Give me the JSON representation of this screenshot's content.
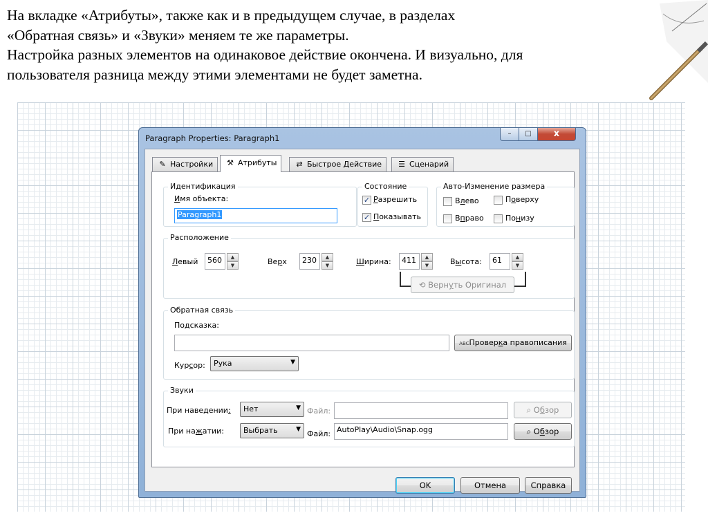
{
  "slide": {
    "line1": "На вкладке «Атрибуты», также как и в предыдущем случае, в разделах",
    "line2": "«Обратная связь» и «Звуки» меняем те же параметры.",
    "line3": "Настройка разных элементов на одинаковое действие окончена. И визуально, для",
    "line4": "пользователя разница между этими элементами не будет заметна."
  },
  "window": {
    "title": "Paragraph Properties: Paragraph1",
    "min_glyph": "–",
    "max_glyph": "□",
    "close_glyph": "x"
  },
  "tabs": [
    {
      "label": "Настройки",
      "icon": "pencil-icon",
      "glyph": "✎"
    },
    {
      "label": "Атрибуты",
      "icon": "tools-icon",
      "glyph": "⚒",
      "active": true
    },
    {
      "label": "Быстрое Действие",
      "icon": "quick-action-icon",
      "glyph": "⇄"
    },
    {
      "label": "Сценарий",
      "icon": "script-icon",
      "glyph": "☰"
    }
  ],
  "identification": {
    "legend": "Идентификация",
    "name_label_u": "И",
    "name_label_rest": "мя объекта:",
    "name_value": "Paragraph1"
  },
  "state": {
    "legend": "Состояние",
    "enable_u": "Р",
    "enable_rest": "азрешить",
    "enable_checked": true,
    "show_u": "П",
    "show_rest": "оказывать",
    "show_checked": true,
    "check_glyph": "✓"
  },
  "autosize": {
    "legend": "Авто-Изменение размера",
    "left_pre": "В",
    "left_u": "л",
    "left_post": "ево",
    "top_pre": "П",
    "top_u": "о",
    "top_post": "верху",
    "right_pre": "В",
    "right_u": "п",
    "right_post": "раво",
    "bottom_pre": "По",
    "bottom_u": "н",
    "bottom_post": "изу"
  },
  "position": {
    "legend": "Расположение",
    "left_u": "Л",
    "left_rest": "евый",
    "left_value": "560",
    "top_pre": "Ве",
    "top_u": "р",
    "top_post": "х",
    "top_value": "230",
    "width_u": "Ш",
    "width_rest": "ирина:",
    "width_value": "411",
    "height_pre": "В",
    "height_u": "ы",
    "height_post": "сота:",
    "height_value": "61",
    "restore_pre": "Верн",
    "restore_u": "у",
    "restore_post": "ть Оригинал",
    "spin_up": "▲",
    "spin_down": "▼"
  },
  "feedback": {
    "legend": "Обратная связь",
    "tooltip_pre": "По",
    "tooltip_u": "д",
    "tooltip_post": "сказка:",
    "tooltip_value": "",
    "spell_icon_text": "ABC",
    "spell_pre": "Провер",
    "spell_u": "к",
    "spell_post": "а правописания",
    "cursor_pre": "Кур",
    "cursor_u": "с",
    "cursor_post": "ор:",
    "cursor_value": "Рука",
    "dd_glyph": "▼"
  },
  "sounds": {
    "legend": "Звуки",
    "hover_label_pre": "При наведении",
    "hover_label_u": ":",
    "hover_value": "Нет",
    "hover_file_label": "Файл:",
    "hover_file_value": "",
    "browse_pre": "О",
    "browse_u": "б",
    "browse_post": "зор",
    "click_label_pre": "При на",
    "click_label_u": "ж",
    "click_label_post": "атии:",
    "click_value": "Выбрать",
    "click_file_label": "Файл:",
    "click_file_value": "AutoPlay\\Audio\\Snap.ogg"
  },
  "buttons": {
    "ok": "OK",
    "cancel": "Отмена",
    "help": "Справка"
  }
}
